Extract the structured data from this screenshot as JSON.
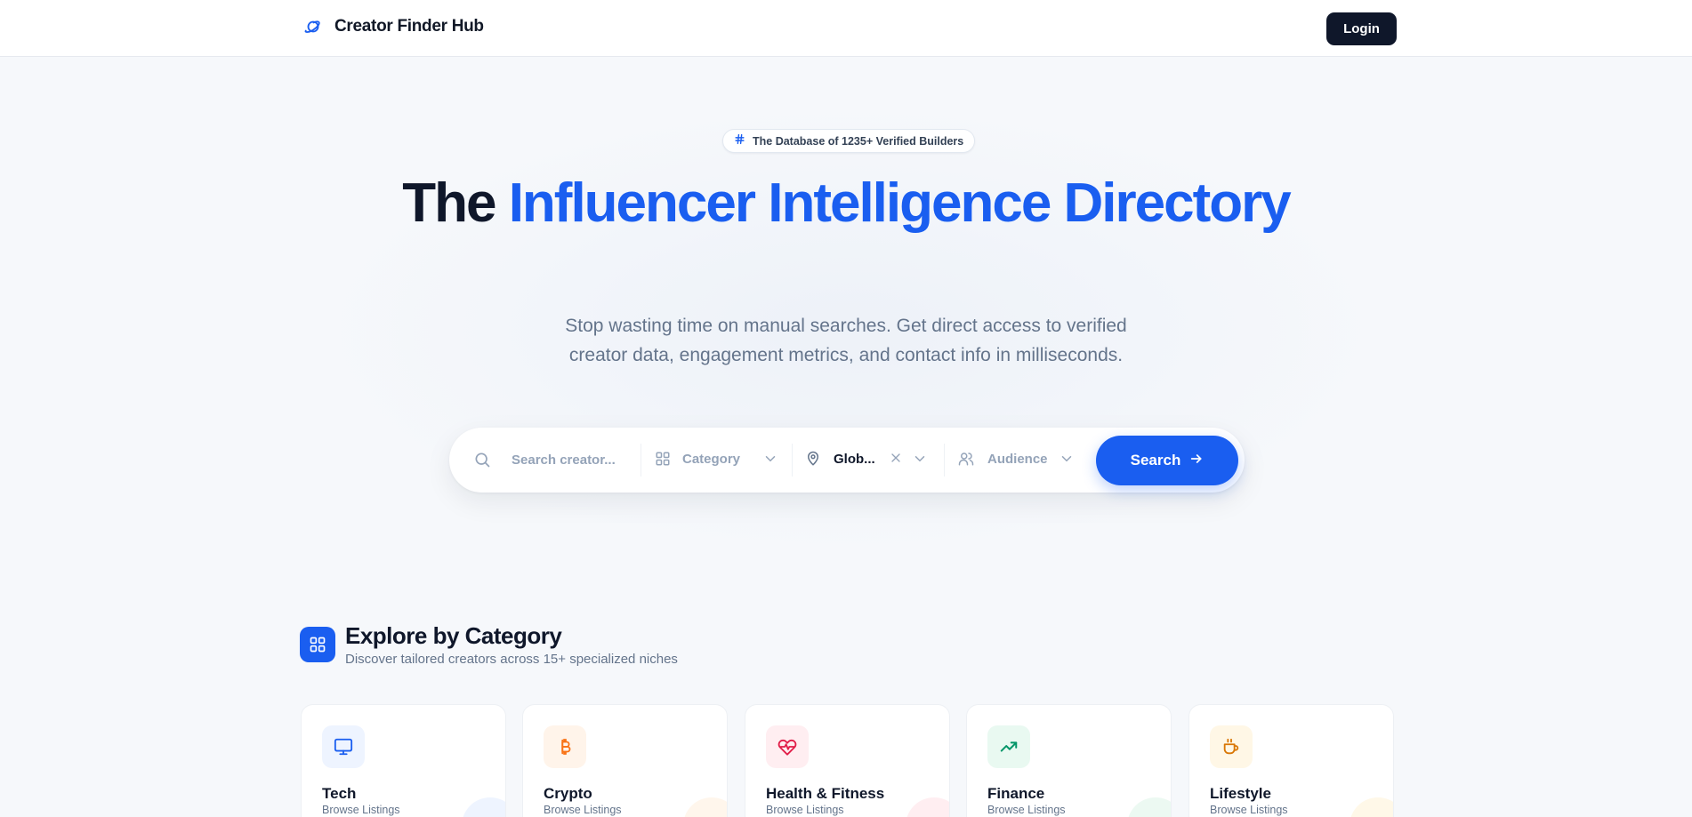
{
  "navbar": {
    "brand": "Creator Finder Hub",
    "brand_icon": "planet-icon",
    "login_label": "Login"
  },
  "hero": {
    "badge": "The Database of 1235+ Verified Builders",
    "badge_icon": "hash-icon",
    "title_dark": "The",
    "title_blue": "Influencer Intelligence Directory",
    "subtitle": "Stop wasting time on manual searches. Get direct access to verified creator data, engagement metrics, and contact info in milliseconds."
  },
  "search": {
    "placeholder": "Search creator...",
    "category_label": "Category",
    "location_value": "Glob...",
    "audience_label": "Audience",
    "button_label": "Search"
  },
  "categories": {
    "title": "Explore by Category",
    "subtitle": "Discover tailored creators across 15+ specialized niches",
    "items": [
      {
        "name": "Tech",
        "sub": "Browse Listings",
        "icon": "monitor-icon",
        "color": "#1a5ef0",
        "bg": "#eef4ff"
      },
      {
        "name": "Crypto",
        "sub": "Browse Listings",
        "icon": "bitcoin-icon",
        "color": "#f97316",
        "bg": "#fff4ea"
      },
      {
        "name": "Health & Fitness",
        "sub": "Browse Listings",
        "icon": "heart-pulse-icon",
        "color": "#e11d48",
        "bg": "#ffeef1"
      },
      {
        "name": "Finance",
        "sub": "Browse Listings",
        "icon": "trending-up-icon",
        "color": "#059669",
        "bg": "#e9f9f1"
      },
      {
        "name": "Lifestyle",
        "sub": "Browse Listings",
        "icon": "coffee-icon",
        "color": "#d97706",
        "bg": "#fff7e6"
      }
    ]
  },
  "colors": {
    "accent": "#1a5ef0",
    "dark": "#0f172a",
    "muted": "#64748b"
  }
}
